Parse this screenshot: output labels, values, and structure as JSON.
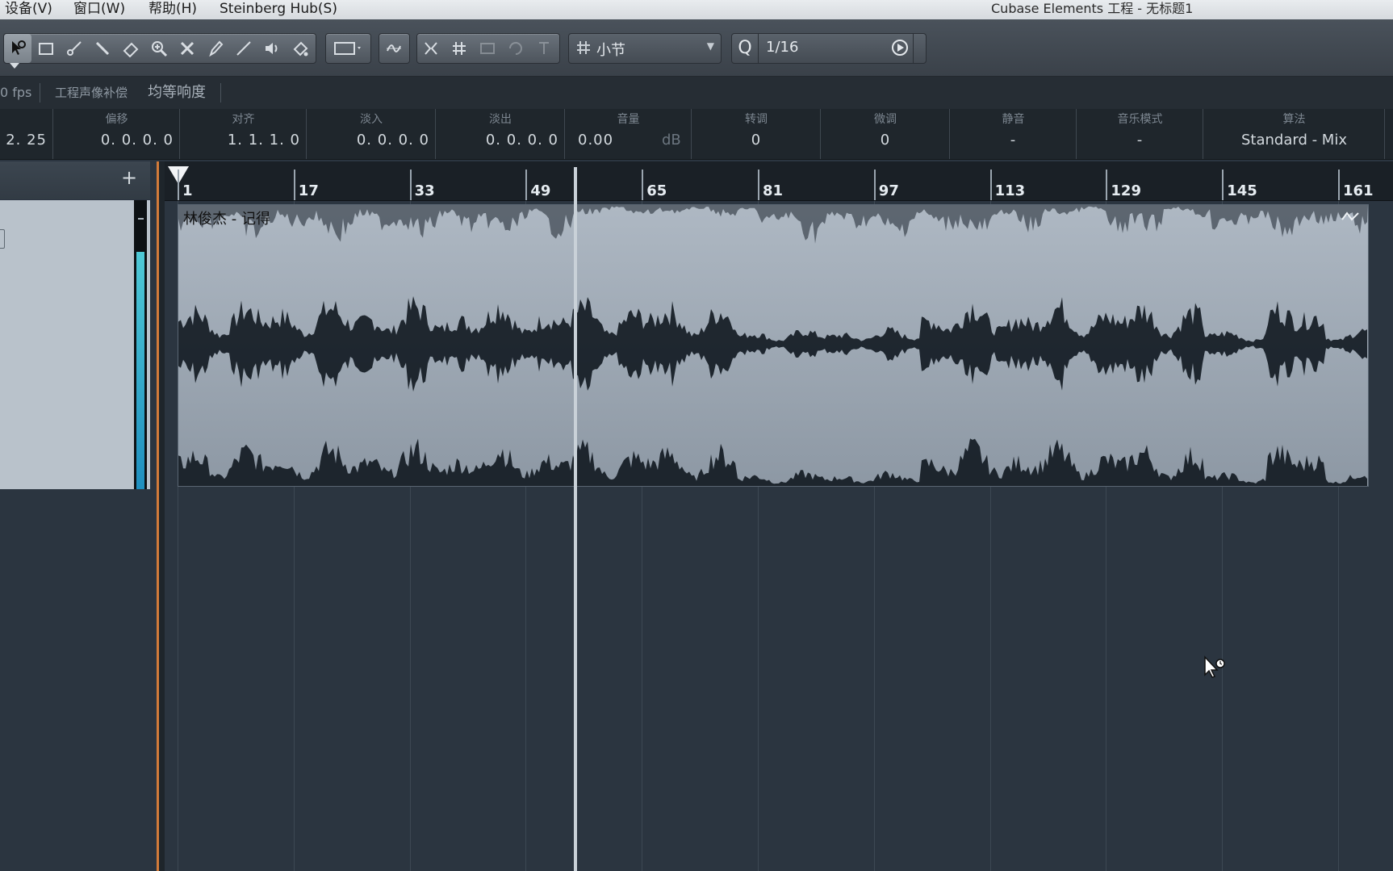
{
  "menubar": {
    "items": [
      "设备(V)",
      "窗口(W)",
      "帮助(H)",
      "Steinberg Hub(S)"
    ],
    "window_title": "Cubase Elements 工程 - 无标题1"
  },
  "toolbar": {
    "tools": [
      "object-selection",
      "range-selection",
      "split",
      "glue",
      "erase",
      "zoom",
      "mute",
      "draw",
      "line",
      "play",
      "color"
    ],
    "grid_type": "小节",
    "quantize_label": "Q",
    "quantize_value": "1/16"
  },
  "infobar": {
    "fps": "0 fps",
    "item1": "工程声像补偿",
    "item2": "均等响度"
  },
  "params": [
    {
      "label": "",
      "value": "2. 25"
    },
    {
      "label": "偏移",
      "value": "0. 0. 0.   0"
    },
    {
      "label": "对齐",
      "value": "1. 1. 1.   0"
    },
    {
      "label": "淡入",
      "value": "0. 0. 0.   0"
    },
    {
      "label": "淡出",
      "value": "0. 0. 0.   0"
    },
    {
      "label": "音量",
      "value": "0.00",
      "unit": "dB"
    },
    {
      "label": "转调",
      "value": "0"
    },
    {
      "label": "微调",
      "value": "0"
    },
    {
      "label": "静音",
      "value": "-"
    },
    {
      "label": "音乐模式",
      "value": "-"
    },
    {
      "label": "算法",
      "value": "Standard - Mix"
    }
  ],
  "trackpanel": {
    "add_label": "+",
    "meter_level": 0.82
  },
  "ruler": {
    "bars": [
      "1",
      "17",
      "33",
      "49",
      "65",
      "81",
      "97",
      "113",
      "129",
      "145",
      "161"
    ]
  },
  "event": {
    "name": "林俊杰 - 记得"
  },
  "colors": {
    "accent": "#d27b3a",
    "meter": "#35b4d0",
    "waveform": "#111820"
  }
}
